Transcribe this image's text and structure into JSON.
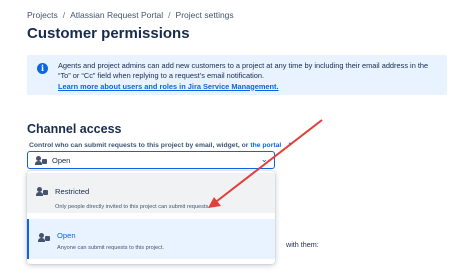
{
  "breadcrumb": [
    "Projects",
    "Atlassian Request Portal",
    "Project settings"
  ],
  "page_title": "Customer permissions",
  "info": {
    "text": "Agents and project admins can add new customers to a project at any time by including their email address in the “To” or “Cc” field when replying to a request’s email notification.",
    "link": "Learn more about users and roles in Jira Service Management."
  },
  "channel": {
    "title": "Channel access",
    "label_prefix": "Control who can submit requests to this project by email, widget, or",
    "label_link": "the portal",
    "selected": "Open",
    "options": [
      {
        "title": "Restricted",
        "description": "Only people directly invited to this project can submit requests."
      },
      {
        "title": "Open",
        "description": "Anyone can submit requests to this project."
      }
    ]
  },
  "background_text": "with them:",
  "colors": {
    "accent": "#0c66e4",
    "info_bg": "#e9f2ff",
    "arrow": "#e0403a"
  },
  "icons": [
    "info-icon",
    "external-link-icon",
    "user-lock-icon",
    "chevron-down-icon"
  ]
}
